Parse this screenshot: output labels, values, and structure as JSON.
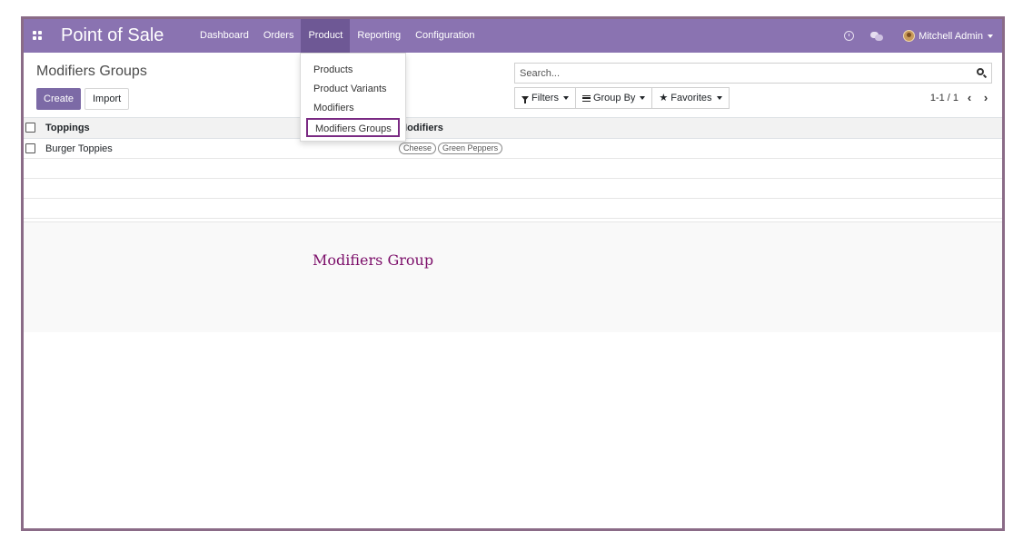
{
  "navbar": {
    "app_title": "Point of Sale",
    "menu": [
      "Dashboard",
      "Orders",
      "Product",
      "Reporting",
      "Configuration"
    ],
    "active_menu": "Product",
    "user_name": "Mitchell Admin",
    "color": "#8a73b1"
  },
  "breadcrumb": "Modifiers Groups",
  "buttons": {
    "create": "Create",
    "import": "Import"
  },
  "search": {
    "placeholder": "Search..."
  },
  "filters": {
    "filters": "Filters",
    "group_by": "Group By",
    "favorites": "Favorites"
  },
  "pager": {
    "value": "1-1 / 1",
    "prev": "‹",
    "next": "›"
  },
  "list": {
    "columns": [
      "Toppings",
      "Modifiers"
    ],
    "rows": [
      {
        "name": "Burger Toppies",
        "tags": [
          "Cheese",
          "Green Peppers"
        ]
      }
    ]
  },
  "dropdown": {
    "items": [
      "Products",
      "Product Variants",
      "Modifiers",
      "Modifiers Groups"
    ],
    "selected": "Modifiers Groups"
  },
  "caption": "Modifiers Group"
}
